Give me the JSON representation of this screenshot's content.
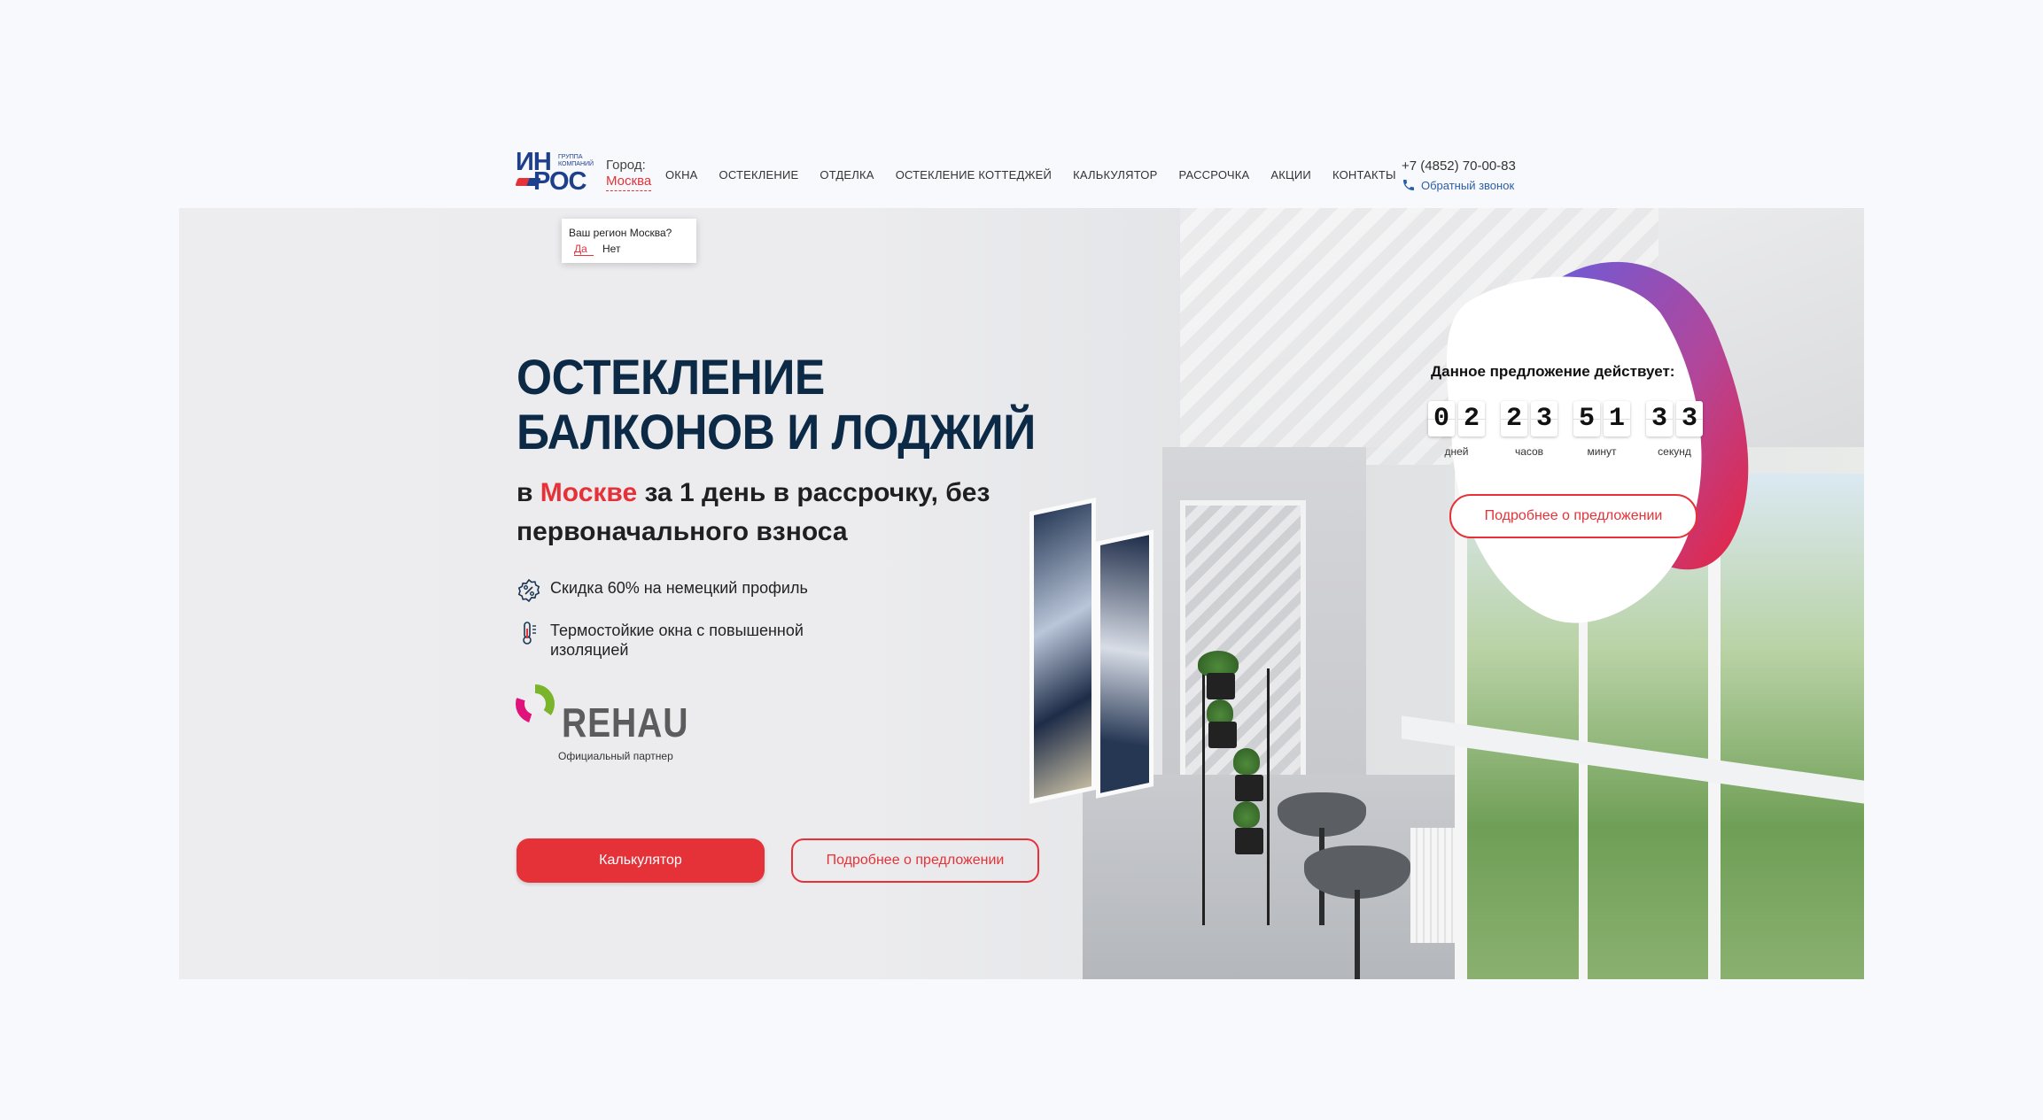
{
  "header": {
    "logo": {
      "line1": "ИН",
      "line2": "РОС",
      "small": "ГРУППА КОМПАНИЙ"
    },
    "city_label": "Город:",
    "city_value": "Москва",
    "nav": [
      "ОКНА",
      "ОСТЕКЛЕНИЕ",
      "ОТДЕЛКА",
      "ОСТЕКЛЕНИЕ КОТТЕДЖЕЙ",
      "КАЛЬКУЛЯТОР",
      "РАССРОЧКА",
      "АКЦИИ",
      "КОНТАКТЫ"
    ],
    "phone": "+7 (4852) 70-00-83",
    "callback": "Обратный звонок"
  },
  "region_popup": {
    "question": "Ваш регион Москва?",
    "yes": "Да",
    "no": "Нет"
  },
  "hero": {
    "title_line1": "ОСТЕКЛЕНИЕ",
    "title_line2": "БАЛКОНОВ И ЛОДЖИЙ",
    "subtitle_prefix": "в ",
    "subtitle_city": "Москве",
    "subtitle_rest": " за 1 день в рассрочку, без первоначального взноса",
    "features": [
      {
        "icon": "discount-percent-icon",
        "text": "Скидка 60% на немецкий профиль"
      },
      {
        "icon": "thermometer-icon",
        "text": "Термостойкие окна с повышенной изоляцией"
      }
    ],
    "partner": {
      "brand": "REHAU",
      "caption": "Официальный партнер"
    },
    "btn_calculator": "Калькулятор",
    "btn_details": "Подробнее о предложении"
  },
  "offer": {
    "title": "Данное предложение действует:",
    "timer": [
      {
        "digits": [
          "0",
          "2"
        ],
        "unit": "дней"
      },
      {
        "digits": [
          "2",
          "3"
        ],
        "unit": "часов"
      },
      {
        "digits": [
          "5",
          "1"
        ],
        "unit": "минут"
      },
      {
        "digits": [
          "3",
          "3"
        ],
        "unit": "секунд"
      }
    ],
    "button": "Подробнее о предложении"
  },
  "colors": {
    "accent_red": "#e53239",
    "navy": "#0c2a46",
    "brand_blue": "#1e3f8c",
    "blob_purple": "#7a5ad6"
  }
}
